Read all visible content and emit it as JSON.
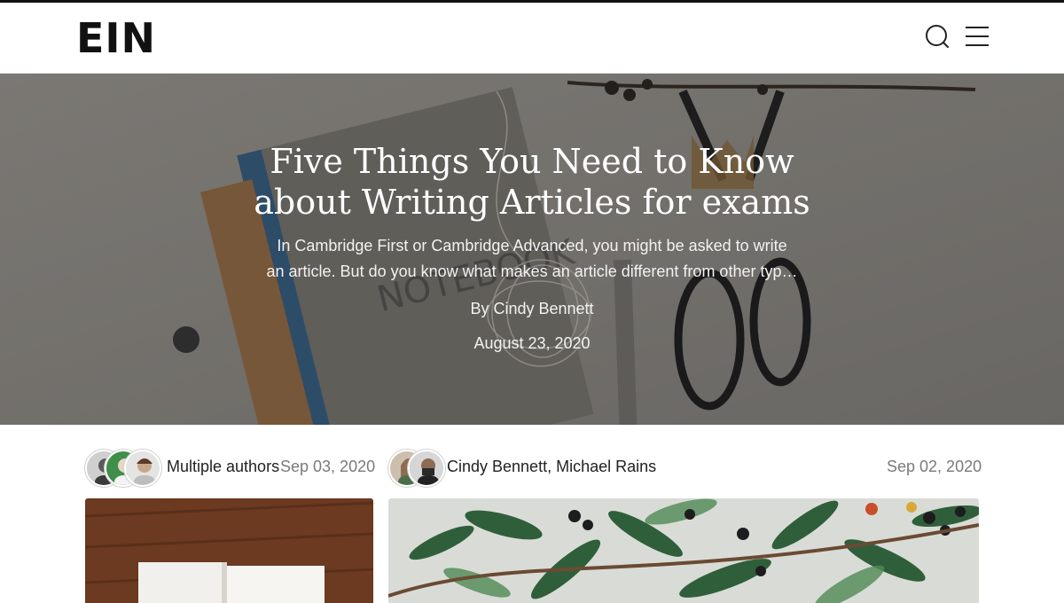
{
  "header": {
    "logo": "EIN",
    "icons": [
      "search-icon",
      "menu-icon"
    ]
  },
  "hero": {
    "title": "Five Things You Need to Know about Writing Articles for exams",
    "excerpt": "In Cambridge First or Cambridge Advanced, you might be asked to write an article. But do you know what makes an article different from other typ…",
    "author": "By Cindy Bennett",
    "date": "August 23, 2020"
  },
  "posts": [
    {
      "authors": "Multiple authors",
      "date": "Sep 03, 2020",
      "avatar_count": 3
    },
    {
      "authors": "Cindy Bennett, Michael Rains",
      "date": "Sep 02, 2020",
      "avatar_count": 2
    }
  ],
  "colors": {
    "text": "#222222",
    "muted": "#7a7a7a",
    "hero_text": "#ffffff"
  }
}
